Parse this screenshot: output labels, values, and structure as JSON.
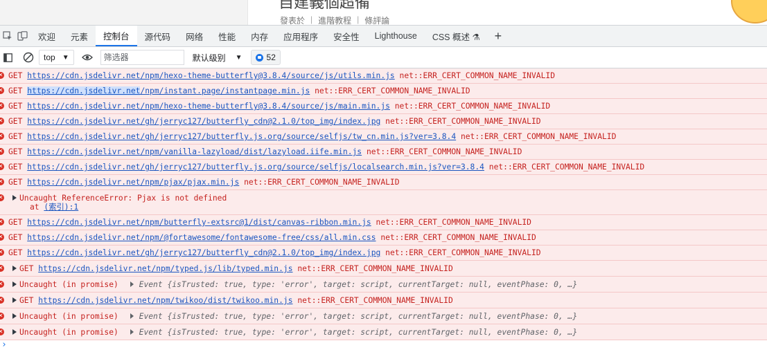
{
  "page": {
    "heading": "自建義個超備",
    "meta": [
      "發表於",
      "進階教程",
      "條評論"
    ],
    "meta_separator": "|"
  },
  "devtools": {
    "tabs": [
      {
        "label": "欢迎",
        "active": false
      },
      {
        "label": "元素",
        "active": false
      },
      {
        "label": "控制台",
        "active": true
      },
      {
        "label": "源代码",
        "active": false
      },
      {
        "label": "网络",
        "active": false
      },
      {
        "label": "性能",
        "active": false
      },
      {
        "label": "内存",
        "active": false
      },
      {
        "label": "应用程序",
        "active": false
      },
      {
        "label": "安全性",
        "active": false
      },
      {
        "label": "Lighthouse",
        "active": false
      },
      {
        "label": "CSS 概述 ⚗",
        "active": false
      }
    ],
    "add_tab": "+"
  },
  "toolbar": {
    "context": "top",
    "filter_placeholder": "筛选器",
    "level": "默认级别",
    "issues_count": "52"
  },
  "console": {
    "error_suffix": "net::ERR_CERT_COMMON_NAME_INVALID",
    "rows": [
      {
        "type": "get",
        "method": "GET",
        "url": "https://cdn.jsdelivr.net/npm/hexo-theme-butterfly@3.8.4/source/js/utils.min.js",
        "error": "net::ERR_CERT_COMMON_NAME_INVALID"
      },
      {
        "type": "get-hl",
        "method": "GET",
        "url_hl": "https://cdn.jsdelivr.net",
        "url_rest": "/npm/instant.page/instantpage.min.js",
        "error": "net::ERR_CERT_COMMON_NAME_INVALID"
      },
      {
        "type": "get",
        "method": "GET",
        "url": "https://cdn.jsdelivr.net/npm/hexo-theme-butterfly@3.8.4/source/js/main.min.js",
        "error": "net::ERR_CERT_COMMON_NAME_INVALID"
      },
      {
        "type": "get",
        "method": "GET",
        "url": "https://cdn.jsdelivr.net/gh/jerryc127/butterfly_cdn@2.1.0/top_img/index.jpg",
        "error": "net::ERR_CERT_COMMON_NAME_INVALID"
      },
      {
        "type": "get",
        "method": "GET",
        "url": "https://cdn.jsdelivr.net/gh/jerryc127/butterfly.js.org/source/selfjs/tw_cn.min.js?ver=3.8.4",
        "error": "net::ERR_CERT_COMMON_NAME_INVALID"
      },
      {
        "type": "get",
        "method": "GET",
        "url": "https://cdn.jsdelivr.net/npm/vanilla-lazyload/dist/lazyload.iife.min.js",
        "error": "net::ERR_CERT_COMMON_NAME_INVALID"
      },
      {
        "type": "get",
        "method": "GET",
        "url": "https://cdn.jsdelivr.net/gh/jerryc127/butterfly.js.org/source/selfjs/localsearch.min.js?ver=3.8.4",
        "error": "net::ERR_CERT_COMMON_NAME_INVALID"
      },
      {
        "type": "get",
        "method": "GET",
        "url": "https://cdn.jsdelivr.net/npm/pjax/pjax.min.js",
        "error": "net::ERR_CERT_COMMON_NAME_INVALID"
      },
      {
        "type": "ref",
        "message": "Uncaught ReferenceError: Pjax is not defined",
        "stack_prefix": "at ",
        "stack_link": "(索引):1"
      },
      {
        "type": "get",
        "method": "GET",
        "url": "https://cdn.jsdelivr.net/npm/butterfly-extsrc@1/dist/canvas-ribbon.min.js",
        "error": "net::ERR_CERT_COMMON_NAME_INVALID"
      },
      {
        "type": "get",
        "method": "GET",
        "url": "https://cdn.jsdelivr.net/npm/@fortawesome/fontawesome-free/css/all.min.css",
        "error": "net::ERR_CERT_COMMON_NAME_INVALID"
      },
      {
        "type": "get",
        "method": "GET",
        "url": "https://cdn.jsdelivr.net/gh/jerryc127/butterfly_cdn@2.1.0/top_img/index.jpg",
        "error": "net::ERR_CERT_COMMON_NAME_INVALID"
      },
      {
        "type": "get-exp",
        "method": "GET",
        "url": "https://cdn.jsdelivr.net/npm/typed.js/lib/typed.min.js",
        "error": "net::ERR_CERT_COMMON_NAME_INVALID"
      },
      {
        "type": "promise",
        "message": "Uncaught (in promise)",
        "object": "Event {isTrusted: true, type: 'error', target: script, currentTarget: null, eventPhase: 0, …}"
      },
      {
        "type": "get-exp",
        "method": "GET",
        "url": "https://cdn.jsdelivr.net/npm/twikoo/dist/twikoo.min.js",
        "error": "net::ERR_CERT_COMMON_NAME_INVALID"
      },
      {
        "type": "promise",
        "message": "Uncaught (in promise)",
        "object": "Event {isTrusted: true, type: 'error', target: script, currentTarget: null, eventPhase: 0, …}"
      },
      {
        "type": "promise",
        "message": "Uncaught (in promise)",
        "object": "Event {isTrusted: true, type: 'error', target: script, currentTarget: null, eventPhase: 0, …}"
      }
    ],
    "prompt": "›"
  },
  "colors": {
    "error_bg": "#fcebeb",
    "error_text": "#c5221f",
    "link": "#1a55c0",
    "accent": "#1a73e8"
  }
}
